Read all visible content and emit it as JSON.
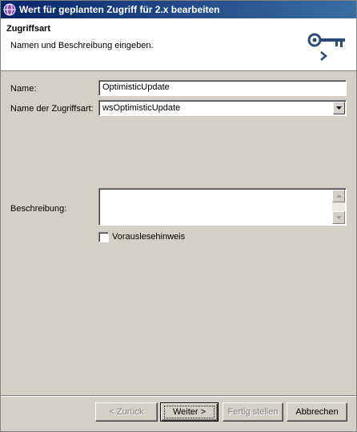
{
  "window": {
    "title": "Wert für geplanten Zugriff für 2.x bearbeiten"
  },
  "banner": {
    "heading": "Zugriffsart",
    "subtitle": "Namen und Beschreibung eingeben.",
    "icon": "key-icon"
  },
  "form": {
    "name_label": "Name:",
    "name_value": "OptimisticUpdate",
    "access_type_label": "Name der Zugriffsart:",
    "access_type_value": "wsOptimisticUpdate",
    "description_label": "Beschreibung:",
    "description_value": "",
    "prefetch_label": "Vorauslesehinweis",
    "prefetch_checked": false
  },
  "buttons": {
    "back": "< Zurück",
    "next": "Weiter >",
    "finish": "Fertig stellen",
    "cancel": "Abbrechen"
  },
  "colors": {
    "titlebar_start": "#0a246a",
    "titlebar_end": "#3a6ea5",
    "dialog_face": "#d4d0c8",
    "banner_bg": "#ffffff"
  }
}
